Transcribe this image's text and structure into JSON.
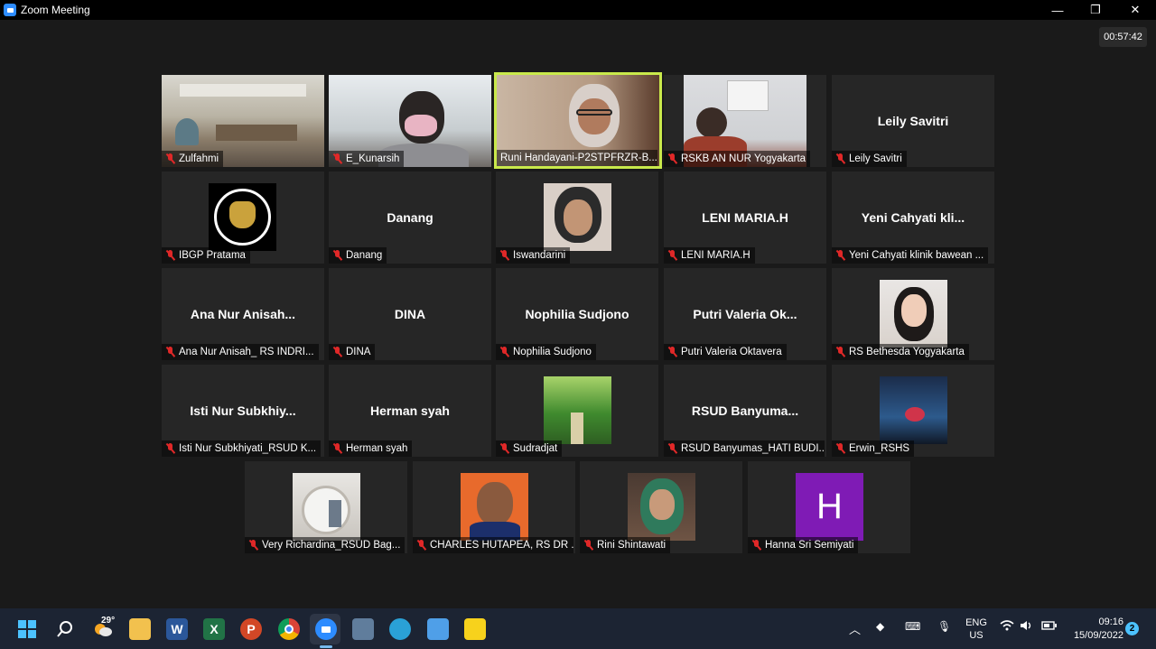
{
  "window": {
    "title": "Zoom Meeting",
    "minimize": "—",
    "maximize": "❐",
    "close": "✕"
  },
  "meeting": {
    "timer": "00:57:42"
  },
  "participants": [
    {
      "name": "Zulfahmi"
    },
    {
      "name": "E_Kunarsih"
    },
    {
      "name": "Runi Handayani-P2STPFRZR-B..."
    },
    {
      "name": "RSKB AN NUR Yogyakarta"
    },
    {
      "name": "Leily Savitri",
      "display": "Leily Savitri"
    },
    {
      "name": "IBGP Pratama"
    },
    {
      "name": "Danang",
      "display": "Danang"
    },
    {
      "name": "Iswandarini"
    },
    {
      "name": "LENI MARIA.H",
      "display": "LENI MARIA.H"
    },
    {
      "name": "Yeni Cahyati klinik bawean ...",
      "display": "Yeni  Cahyati  kli..."
    },
    {
      "name": "Ana Nur Anisah_ RS INDRI...",
      "display": "Ana  Nur  Anisah..."
    },
    {
      "name": "DINA",
      "display": "DINA"
    },
    {
      "name": "Nophilia Sudjono",
      "display": "Nophilia  Sudjono"
    },
    {
      "name": "Putri Valeria Oktavera",
      "display": "Putri  Valeria  Ok..."
    },
    {
      "name": "RS Bethesda Yogyakarta"
    },
    {
      "name": "Isti Nur Subkhiyati_RSUD K...",
      "display": "Isti  Nur  Subkhiy..."
    },
    {
      "name": "Herman syah",
      "display": "Herman syah"
    },
    {
      "name": "Sudradjat"
    },
    {
      "name": "RSUD Banyumas_HATI BUDI...",
      "display": "RSUD  Banyuma..."
    },
    {
      "name": "Erwin_RSHS"
    },
    {
      "name": "Very Richardina_RSUD Bag..."
    },
    {
      "name": "CHARLES HUTAPEA, RS DR ..."
    },
    {
      "name": "Rini Shintawati"
    },
    {
      "name": "Hanna Sri Semiyati",
      "avatar_letter": "H"
    }
  ],
  "taskbar": {
    "weather": "29°",
    "lang_top": "ENG",
    "lang_bottom": "US",
    "time": "09:16",
    "date": "15/09/2022",
    "notifications": "2"
  },
  "colors": {
    "active_border": "#c9e94b",
    "muted_mic": "#e02828",
    "avatar_bg": "#7f1bb5"
  }
}
